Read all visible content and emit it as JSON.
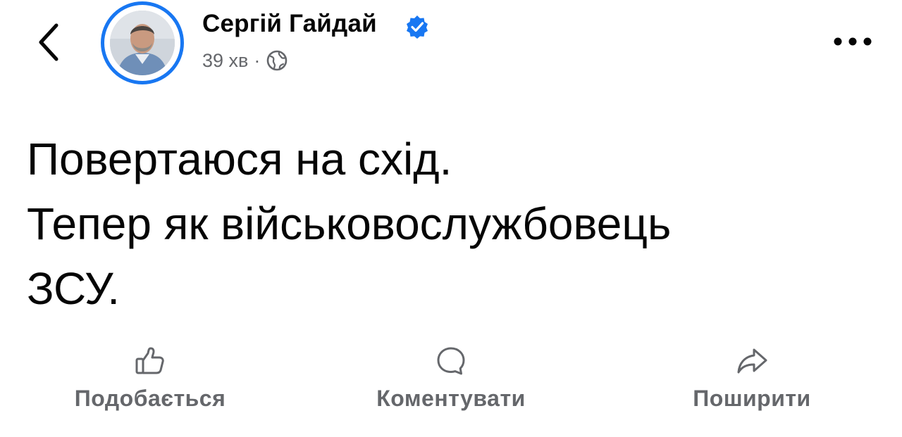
{
  "header": {
    "author_name": "Сергій Гайдай",
    "time": "39 хв",
    "separator": "·"
  },
  "post": {
    "text": "Повертаюся на схід.\nТепер як військовослужбовець\nЗСУ."
  },
  "actions": {
    "like_label": "Подобається",
    "comment_label": "Коментувати",
    "share_label": "Поширити"
  },
  "colors": {
    "accent": "#1877f2",
    "secondary_text": "#65676b",
    "primary_text": "#050505"
  }
}
